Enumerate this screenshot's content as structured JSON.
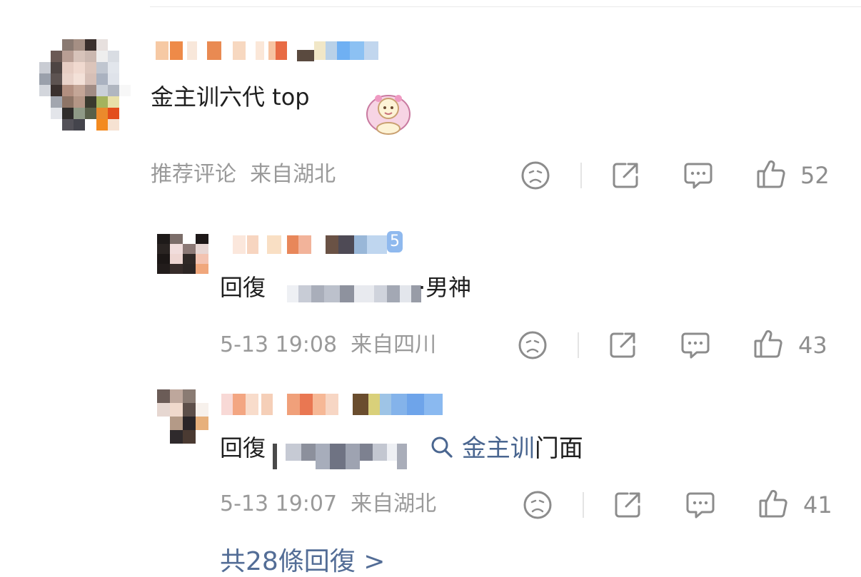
{
  "comment": {
    "text": "金主训六代 top",
    "meta": "推荐评论  来自湖北",
    "like_count": "52"
  },
  "replies": [
    {
      "prefix": "回復",
      "suffix": "·男神",
      "meta": "5-13 19:08  来自四川",
      "like_count": "43",
      "badge": "5"
    },
    {
      "prefix": "回復",
      "search_text": "金主训",
      "suffix": "门面",
      "meta": "5-13 19:07  来自湖北",
      "like_count": "41"
    }
  ],
  "more_replies_label": "共28條回復 >",
  "icons": [
    "dislike-face-icon",
    "share-icon",
    "comment-icon",
    "like-thumb-icon",
    "search-icon"
  ],
  "colors": {
    "link": "#4a6690",
    "meta": "#9a9a9a",
    "icon": "#8c8c8c"
  }
}
